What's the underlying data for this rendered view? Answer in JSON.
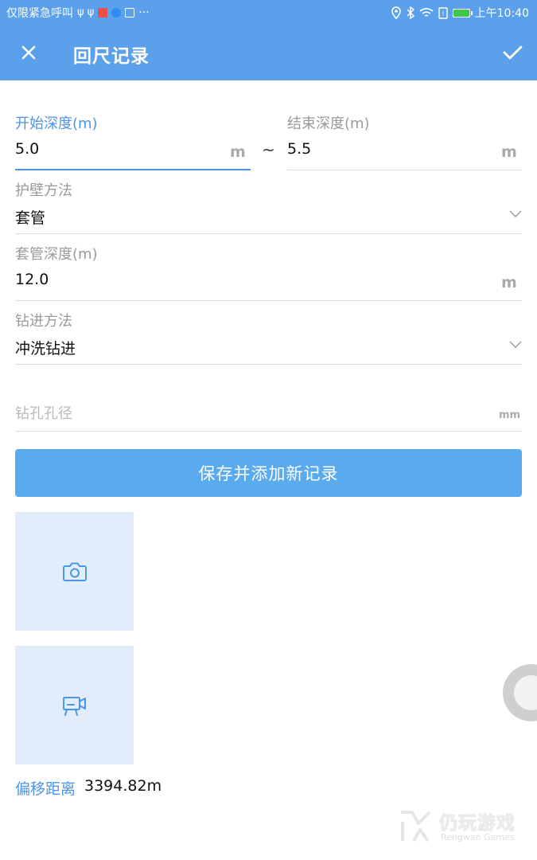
{
  "status_bar": {
    "left_text": "仅限紧急呼叫",
    "usb_icons": "ψ ψ",
    "more": "···",
    "time": "上午10:40"
  },
  "app_bar": {
    "title": "回尺记录",
    "close_icon": "close-icon",
    "confirm_icon": "check-icon"
  },
  "form": {
    "start_depth": {
      "label": "开始深度(m)",
      "value": "5.0",
      "unit": "m"
    },
    "separator": "~",
    "end_depth": {
      "label": "结束深度(m)",
      "value": "5.5",
      "unit": "m"
    },
    "wall_method": {
      "label": "护壁方法",
      "value": "套管"
    },
    "casing_depth": {
      "label": "套管深度(m)",
      "value": "12.0",
      "unit": "m"
    },
    "drill_method": {
      "label": "钻进方法",
      "value": "冲洗钻进"
    },
    "hole_diameter": {
      "placeholder": "钻孔孔径",
      "unit": "mm"
    }
  },
  "save_button": "保存并添加新记录",
  "media": {
    "photo_icon": "camera-icon",
    "video_icon": "video-camera-icon"
  },
  "offset": {
    "label": "偏移距离",
    "value": "3394.82m"
  },
  "watermark": {
    "cn": "仍玩游戏",
    "en": "Rengwan Games"
  },
  "colors": {
    "primary": "#5aa0ea",
    "accent_text": "#4d95e6",
    "button": "#5aaaee",
    "tile": "#e2edfb"
  }
}
